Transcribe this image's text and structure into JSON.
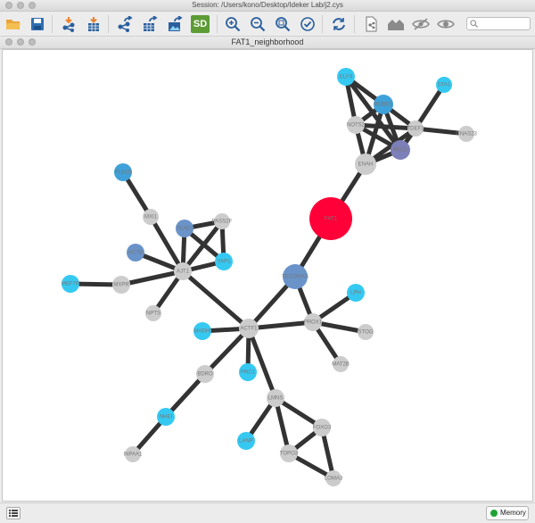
{
  "window": {
    "title": "Session: /Users/kono/Desktop/Ideker Lab/j2.cys"
  },
  "toolbar": {
    "sd_label": "SD",
    "search_placeholder": "",
    "icons": [
      "open-folder-icon",
      "save-icon",
      "import-network-icon",
      "import-table-icon",
      "export-network-icon",
      "export-table-icon",
      "export-image-icon",
      "sd-icon",
      "zoom-in-icon",
      "zoom-out-icon",
      "zoom-selected-icon",
      "zoom-fit-icon",
      "refresh-icon",
      "new-network-from-selection-icon",
      "home-icon",
      "hide-icon",
      "show-icon",
      "search-icon"
    ]
  },
  "network": {
    "title": "FAT1_neighborhood",
    "nodes": [
      {
        "id": "n1",
        "label": "ELF3",
        "color": "#35c9f2"
      },
      {
        "id": "n2",
        "label": "STA1",
        "color": "#35c9f2"
      },
      {
        "id": "n3",
        "label": "ROBO1",
        "color": "#3fa1d9"
      },
      {
        "id": "n4",
        "label": "NOTS2",
        "color": "#cccccc"
      },
      {
        "id": "n5",
        "label": "TDEF1",
        "color": "#cccccc"
      },
      {
        "id": "n6",
        "label": "GNAS23",
        "color": "#cccccc"
      },
      {
        "id": "n7",
        "label": "PALD",
        "color": "#7d7fb8"
      },
      {
        "id": "n8",
        "label": "ENAH",
        "color": "#cccccc"
      },
      {
        "id": "n9",
        "label": "FAT1",
        "color": "#ff0038"
      },
      {
        "id": "n10",
        "label": "PLB1D",
        "color": "#3fa1d9"
      },
      {
        "id": "n11",
        "label": "MXI1",
        "color": "#cccccc"
      },
      {
        "id": "n12",
        "label": "TEAD1",
        "color": "#6a93c9"
      },
      {
        "id": "n13",
        "label": "PASS2F",
        "color": "#cccccc"
      },
      {
        "id": "n14",
        "label": "ACTB",
        "color": "#6a93c9"
      },
      {
        "id": "n15",
        "label": "YAP1",
        "color": "#35c9f2"
      },
      {
        "id": "n16",
        "label": "AJT1",
        "color": "#cccccc"
      },
      {
        "id": "n17",
        "label": "MEF7R",
        "color": "#35c9f2"
      },
      {
        "id": "n18",
        "label": "MXPR",
        "color": "#cccccc"
      },
      {
        "id": "n19",
        "label": "NPTS",
        "color": "#cccccc"
      },
      {
        "id": "n20",
        "label": "TECOMAS",
        "color": "#6a93c9"
      },
      {
        "id": "n21",
        "label": "LPH",
        "color": "#35c9f2"
      },
      {
        "id": "n22",
        "label": "PROX1",
        "color": "#cccccc"
      },
      {
        "id": "n23",
        "label": "STOG",
        "color": "#cccccc"
      },
      {
        "id": "n24",
        "label": "MAT2B",
        "color": "#cccccc"
      },
      {
        "id": "n25",
        "label": "MADHI",
        "color": "#35c9f2"
      },
      {
        "id": "n26",
        "label": "ACTF1",
        "color": "#cccccc"
      },
      {
        "id": "n27",
        "label": "BDRO",
        "color": "#cccccc"
      },
      {
        "id": "n28",
        "label": "PRC1",
        "color": "#35c9f2"
      },
      {
        "id": "n29",
        "label": "NHEI",
        "color": "#35c9f2"
      },
      {
        "id": "n30",
        "label": "INPAA1",
        "color": "#cccccc"
      },
      {
        "id": "n31",
        "label": "LMNS",
        "color": "#cccccc"
      },
      {
        "id": "n32",
        "label": "LANP",
        "color": "#35c9f2"
      },
      {
        "id": "n33",
        "label": "FOXO3",
        "color": "#cccccc"
      },
      {
        "id": "n34",
        "label": "TOPO3",
        "color": "#cccccc"
      },
      {
        "id": "n35",
        "label": "LOMA3",
        "color": "#cccccc"
      }
    ]
  },
  "status": {
    "memory_label": "Memory",
    "memory_color": "#1fa339"
  }
}
